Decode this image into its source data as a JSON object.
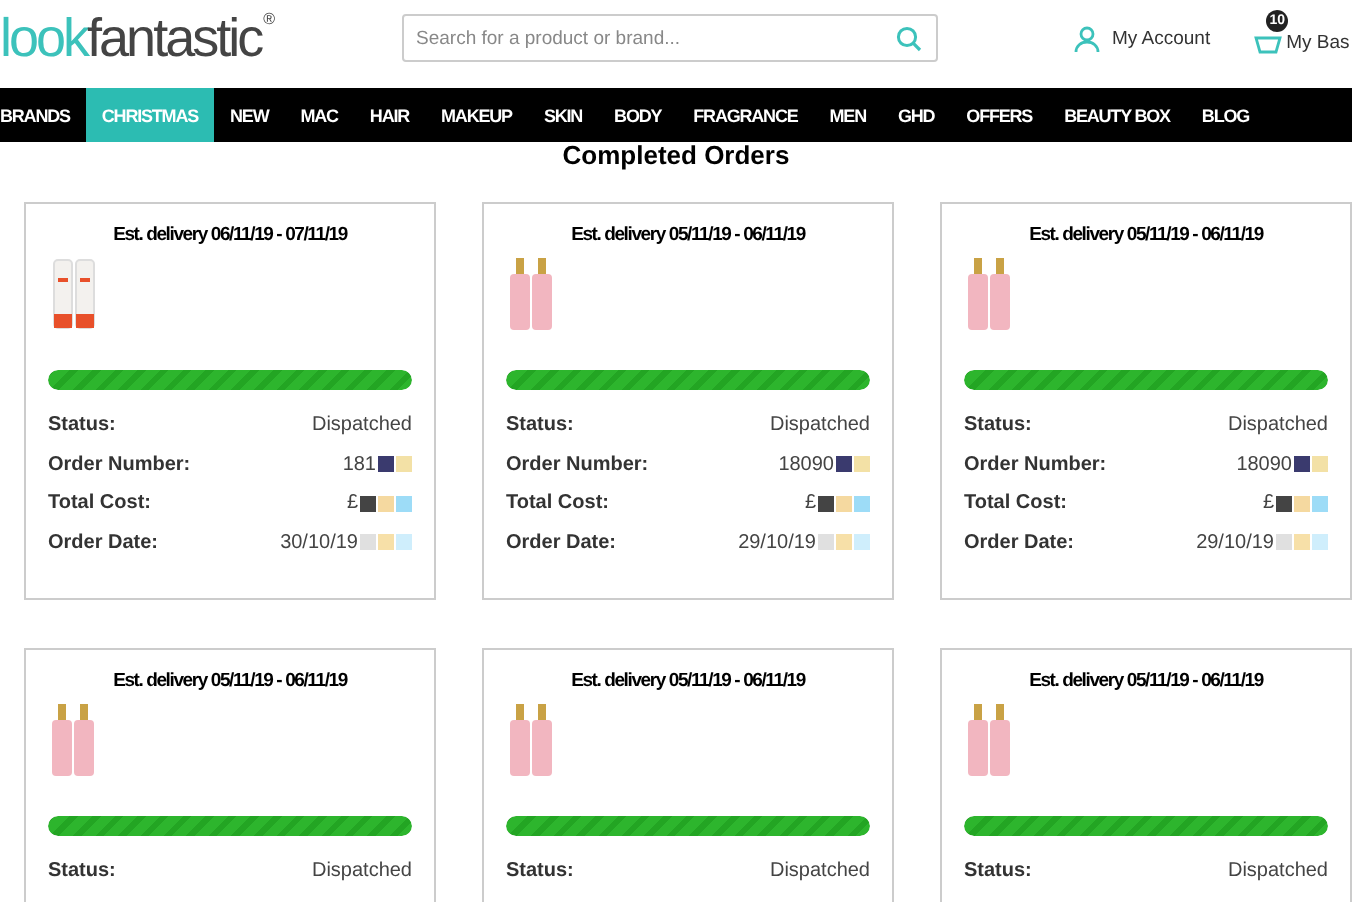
{
  "header": {
    "logo": {
      "part_1": "look",
      "part_2": "fantastic",
      "mark": "®"
    },
    "search": {
      "placeholder": "Search for a product or brand..."
    },
    "account": "My Account",
    "basket": {
      "label": "My Bas",
      "count": "10"
    }
  },
  "nav": [
    {
      "label": "BRANDS",
      "selected": false
    },
    {
      "label": "CHRISTMAS",
      "selected": true
    },
    {
      "label": "NEW",
      "selected": false
    },
    {
      "label": "MAC",
      "selected": false
    },
    {
      "label": "HAIR",
      "selected": false
    },
    {
      "label": "MAKEUP",
      "selected": false
    },
    {
      "label": "SKIN",
      "selected": false
    },
    {
      "label": "BODY",
      "selected": false
    },
    {
      "label": "FRAGRANCE",
      "selected": false
    },
    {
      "label": "MEN",
      "selected": false
    },
    {
      "label": "GHD",
      "selected": false
    },
    {
      "label": "OFFERS",
      "selected": false
    },
    {
      "label": "BEAUTY BOX",
      "selected": false
    },
    {
      "label": "BLOG",
      "selected": false
    }
  ],
  "heading": "Completed Orders",
  "orders": [
    {
      "delivery": "Est. delivery 06/11/19 - 07/11/19",
      "kind": "tube",
      "level": 1,
      "details": [
        {
          "label": "Status:",
          "value": "Dispatched"
        },
        {
          "label": "Order Number:",
          "value": "181"
        },
        {
          "label": "Total Cost:",
          "value": "£"
        },
        {
          "label": "Order Date:",
          "value": "30/10/19"
        }
      ]
    },
    {
      "delivery": "Est. delivery 05/11/19 - 06/11/19",
      "kind": "bottle",
      "level": 1,
      "details": [
        {
          "label": "Status:",
          "value": "Dispatched"
        },
        {
          "label": "Order Number:",
          "value": "18090"
        },
        {
          "label": "Total Cost:",
          "value": "£"
        },
        {
          "label": "Order Date:",
          "value": "29/10/19"
        }
      ]
    },
    {
      "delivery": "Est. delivery 05/11/19 - 06/11/19",
      "kind": "bottle",
      "level": 1,
      "details": [
        {
          "label": "Status:",
          "value": "Dispatched"
        },
        {
          "label": "Order Number:",
          "value": "18090"
        },
        {
          "label": "Total Cost:",
          "value": "£"
        },
        {
          "label": "Order Date:",
          "value": "29/10/19"
        }
      ]
    },
    {
      "delivery": "Est. delivery 05/11/19 - 06/11/19",
      "kind": "bottle",
      "level": 1,
      "details": [
        {
          "label": "Status:",
          "value": "Dispatched"
        }
      ]
    },
    {
      "delivery": "Est. delivery 05/11/19 - 06/11/19",
      "kind": "bottle",
      "level": 1,
      "details": [
        {
          "label": "Status:",
          "value": "Dispatched"
        }
      ]
    },
    {
      "delivery": "Est. delivery 05/11/19 - 06/11/19",
      "kind": "bottle",
      "level": 1,
      "details": [
        {
          "label": "Status:",
          "value": "Dispatched"
        }
      ]
    }
  ]
}
